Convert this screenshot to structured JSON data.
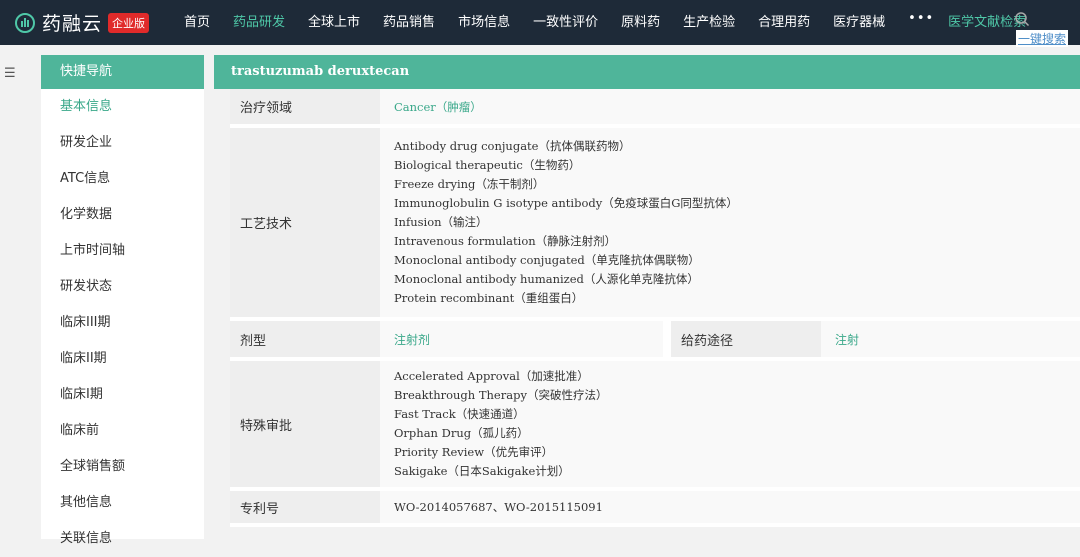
{
  "brand": {
    "name": "药融云",
    "badge": "企业版"
  },
  "nav": {
    "items": [
      {
        "label": "首页",
        "active": false
      },
      {
        "label": "药品研发",
        "active": true
      },
      {
        "label": "全球上市",
        "active": false
      },
      {
        "label": "药品销售",
        "active": false
      },
      {
        "label": "市场信息",
        "active": false
      },
      {
        "label": "一致性评价",
        "active": false
      },
      {
        "label": "原料药",
        "active": false
      },
      {
        "label": "生产检验",
        "active": false
      },
      {
        "label": "合理用药",
        "active": false
      },
      {
        "label": "医疗器械",
        "active": false
      }
    ],
    "more": "•••",
    "literature": "医学文献检索",
    "one_click_search": "一键搜索"
  },
  "sidebar": {
    "header": "快捷导航",
    "items": [
      {
        "label": "基本信息",
        "active": true
      },
      {
        "label": "研发企业",
        "active": false
      },
      {
        "label": "ATC信息",
        "active": false
      },
      {
        "label": "化学数据",
        "active": false
      },
      {
        "label": "上市时间轴",
        "active": false
      },
      {
        "label": "研发状态",
        "active": false
      },
      {
        "label": "临床III期",
        "active": false
      },
      {
        "label": "临床II期",
        "active": false
      },
      {
        "label": "临床I期",
        "active": false
      },
      {
        "label": "临床前",
        "active": false
      },
      {
        "label": "全球销售额",
        "active": false
      },
      {
        "label": "其他信息",
        "active": false
      },
      {
        "label": "关联信息",
        "active": false
      }
    ]
  },
  "content": {
    "title": "trastuzumab deruxtecan",
    "therapy_area": {
      "label": "治疗领域",
      "value": "Cancer（肿瘤）"
    },
    "technology": {
      "label": "工艺技术",
      "values": [
        "Antibody drug conjugate（抗体偶联药物）",
        "Biological therapeutic（生物药）",
        "Freeze drying（冻干制剂）",
        "Immunoglobulin G isotype antibody（免疫球蛋白G同型抗体）",
        "Infusion（输注）",
        "Intravenous formulation（静脉注射剂）",
        "Monoclonal antibody conjugated（单克隆抗体偶联物）",
        "Monoclonal antibody humanized（人源化单克隆抗体）",
        "Protein recombinant（重组蛋白）"
      ]
    },
    "dosage_form": {
      "label": "剂型",
      "value": "注射剂"
    },
    "route": {
      "label": "给药途径",
      "value": "注射"
    },
    "special_review": {
      "label": "特殊审批",
      "values": [
        "Accelerated Approval（加速批准）",
        "Breakthrough Therapy（突破性疗法）",
        "Fast Track（快速通道）",
        "Orphan Drug（孤儿药）",
        "Priority Review（优先审评）",
        "Sakigake（日本Sakigake计划）"
      ]
    },
    "patent": {
      "label": "专利号",
      "value": "WO-2014057687、WO-2015115091"
    }
  },
  "colors": {
    "topbar": "#1e2a38",
    "accent": "#4fb59a",
    "link": "#3aa88a",
    "badge": "#e02a2a"
  }
}
